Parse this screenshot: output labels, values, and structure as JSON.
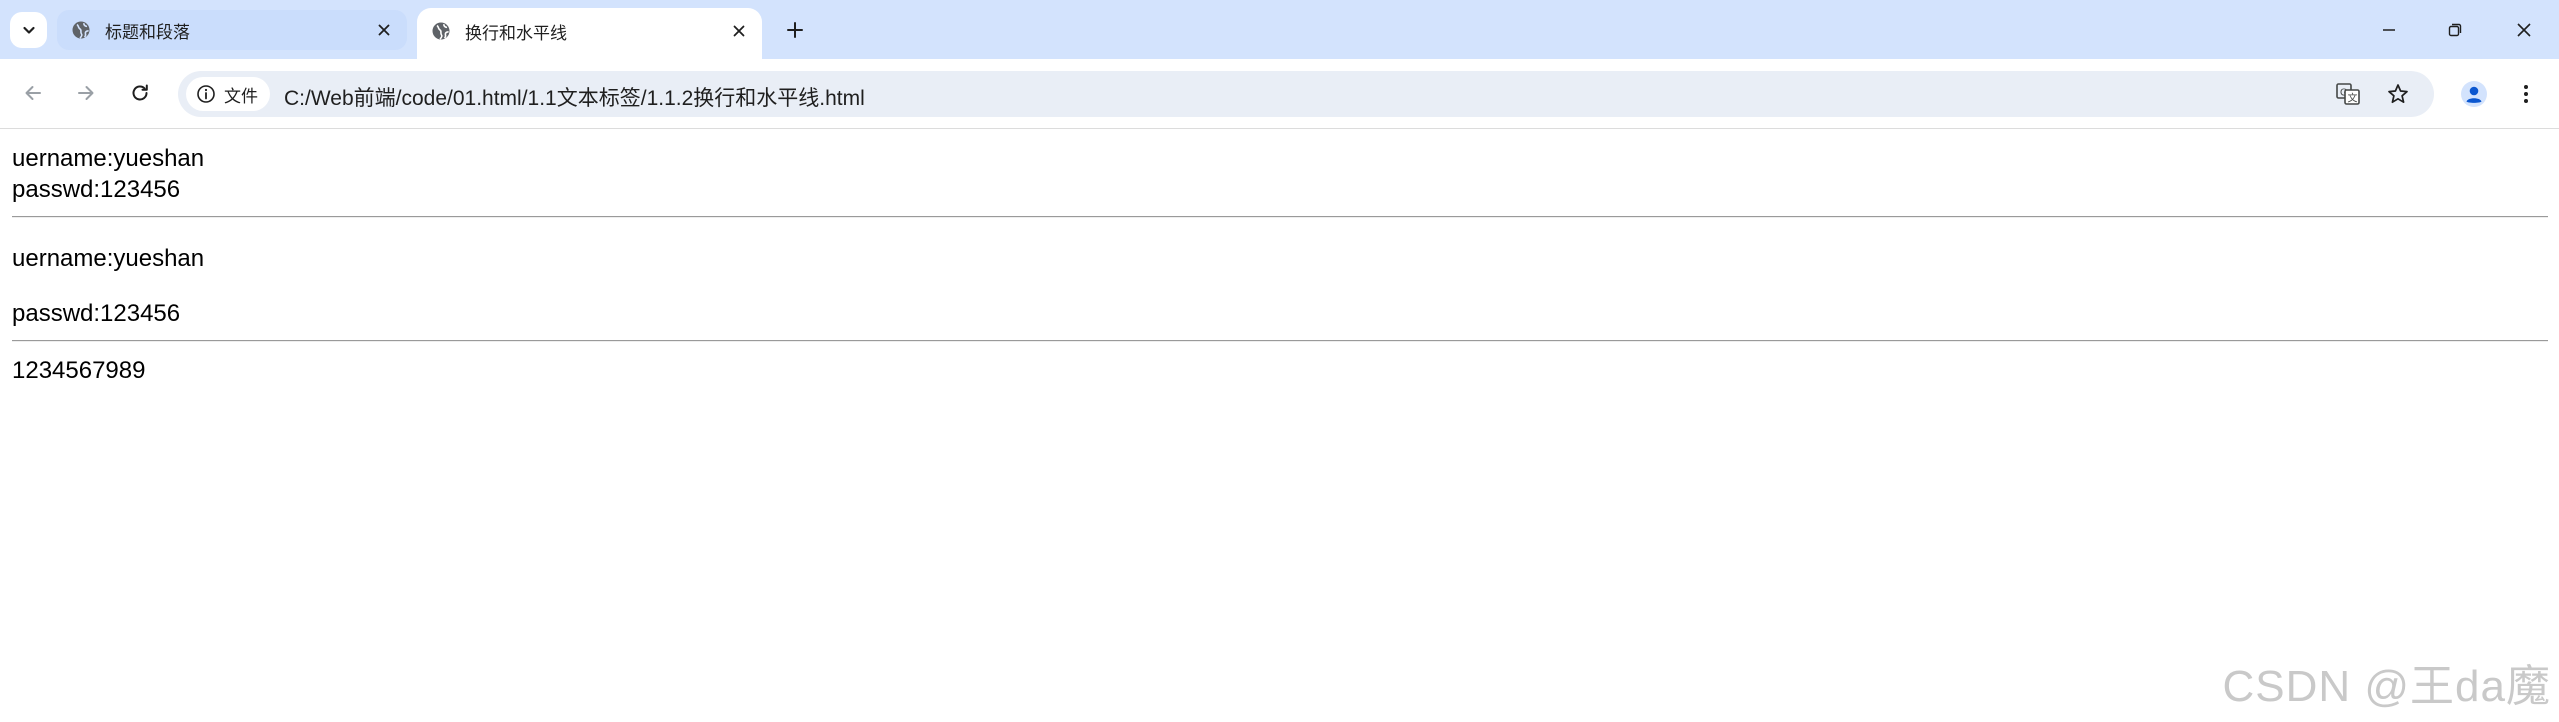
{
  "browser": {
    "tabs": [
      {
        "label": "标题和段落",
        "active": false
      },
      {
        "label": "换行和水平线",
        "active": true
      }
    ],
    "address_bar": {
      "security_chip_label": "文件",
      "url": "C:/Web前端/code/01.html/1.1文本标签/1.1.2换行和水平线.html"
    },
    "icons": {
      "tab_search": "chevron-down-icon",
      "tab_favicon": "globe-icon",
      "back": "arrow-left-icon",
      "forward": "arrow-right-icon",
      "reload": "reload-icon",
      "info": "info-icon",
      "translate": "translate-icon",
      "bookmark": "star-icon",
      "profile": "profile-icon",
      "menu": "kebab-menu-icon"
    },
    "colors": {
      "tabstrip": "#d3e3fd",
      "omnibox": "#e9eef6",
      "accent": "#0b57d0"
    }
  },
  "page": {
    "block1": {
      "line1": "uername:yueshan",
      "line2": "passwd:123456"
    },
    "block2": {
      "para1": "uername:yueshan",
      "para2": "passwd:123456"
    },
    "block3": {
      "text": "1234567989"
    },
    "watermark": "CSDN @王da魔"
  }
}
